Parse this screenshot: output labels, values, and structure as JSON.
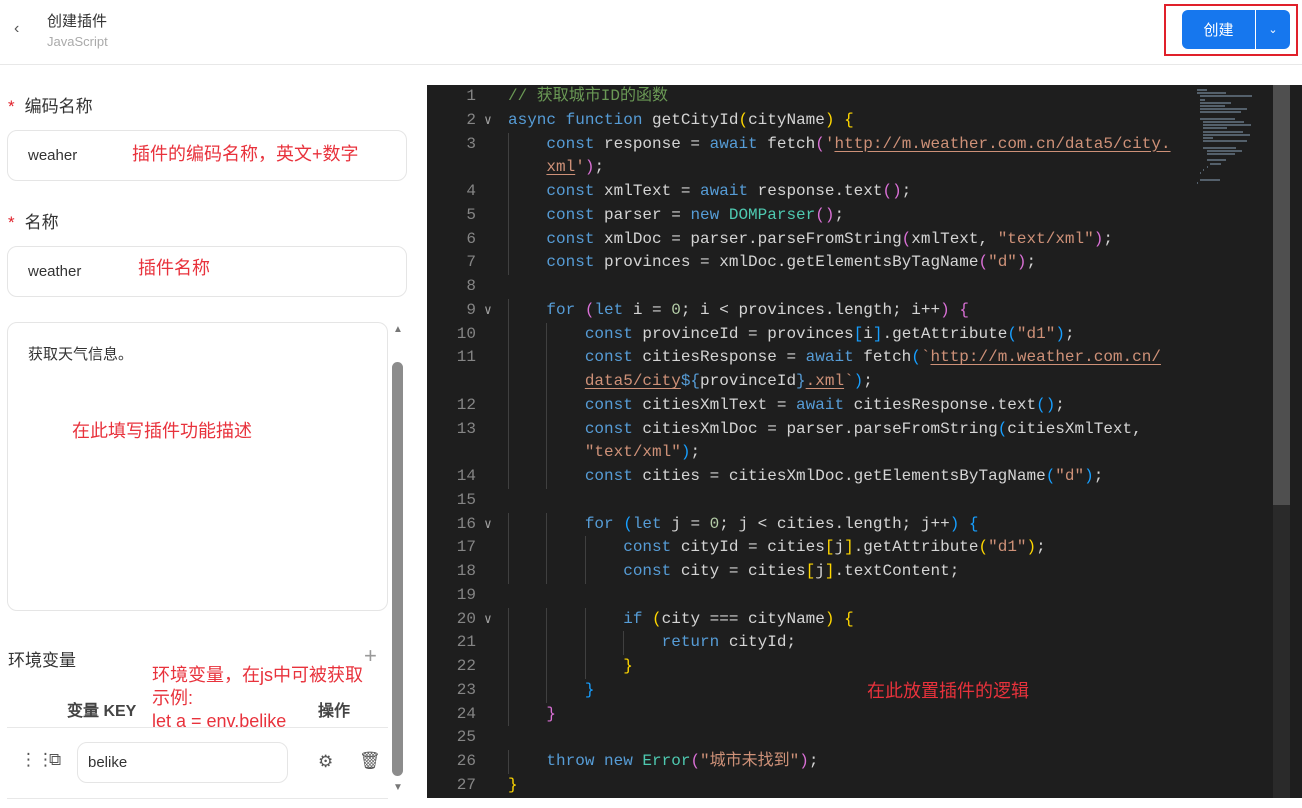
{
  "header": {
    "back_icon": "chevron-left-icon",
    "title": "创建插件",
    "subtitle": "JavaScript",
    "create_label": "创建",
    "dropdown_icon": "chevron-down-icon"
  },
  "form": {
    "code_name": {
      "label": "编码名称",
      "required": "*",
      "value": "weaher",
      "annotation": "插件的编码名称，英文+数字"
    },
    "name": {
      "label": "名称",
      "required": "*",
      "value": "weather",
      "annotation": "插件名称"
    },
    "description": {
      "value": "获取天气信息。",
      "annotation": "在此填写插件功能描述"
    },
    "env": {
      "title": "环境变量",
      "add_icon": "plus-icon",
      "col_key": "变量 KEY",
      "col_action": "操作",
      "annotation": [
        "环境变量，在js中可被获取",
        "示例:",
        "let a = env.belike"
      ],
      "rows": [
        {
          "key": "belike"
        }
      ]
    }
  },
  "editor": {
    "annotation": "在此放置插件的逻辑",
    "colors": {
      "keyword": "#569cd6",
      "string": "#ce9178",
      "comment": "#6a9955",
      "class": "#4ec9b0",
      "background": "#1e1e1e"
    },
    "rows": [
      {
        "n": "1",
        "t": [
          [
            "c",
            "// 获取城市ID的函数"
          ]
        ]
      },
      {
        "n": "2",
        "f": 1,
        "t": [
          [
            "k",
            "async "
          ],
          [
            "k",
            "function "
          ],
          [
            "v",
            "getCityId"
          ],
          [
            "b1",
            "("
          ],
          [
            "v",
            "cityName"
          ],
          [
            "b1",
            ")"
          ],
          [
            "v",
            " "
          ],
          [
            "b1",
            "{"
          ]
        ]
      },
      {
        "n": "3",
        "t": [
          [
            "v",
            "    "
          ],
          [
            "k",
            "const "
          ],
          [
            "v",
            "response = "
          ],
          [
            "k",
            "await "
          ],
          [
            "v",
            "fetch"
          ],
          [
            "b2",
            "("
          ],
          [
            "s",
            "'"
          ],
          [
            "su",
            "http://m.weather.com.cn/data5/city."
          ]
        ]
      },
      {
        "n": "",
        "t": [
          [
            "v",
            "    "
          ],
          [
            "su",
            "xml"
          ],
          [
            "s",
            "'"
          ],
          [
            "b2",
            ")"
          ],
          [
            "v",
            ";"
          ]
        ]
      },
      {
        "n": "4",
        "t": [
          [
            "v",
            "    "
          ],
          [
            "k",
            "const "
          ],
          [
            "v",
            "xmlText = "
          ],
          [
            "k",
            "await "
          ],
          [
            "v",
            "response.text"
          ],
          [
            "b2",
            "()"
          ],
          [
            "v",
            ";"
          ]
        ]
      },
      {
        "n": "5",
        "t": [
          [
            "v",
            "    "
          ],
          [
            "k",
            "const "
          ],
          [
            "v",
            "parser = "
          ],
          [
            "k",
            "new "
          ],
          [
            "cl",
            "DOMParser"
          ],
          [
            "b2",
            "()"
          ],
          [
            "v",
            ";"
          ]
        ]
      },
      {
        "n": "6",
        "t": [
          [
            "v",
            "    "
          ],
          [
            "k",
            "const "
          ],
          [
            "v",
            "xmlDoc = parser.parseFromString"
          ],
          [
            "b2",
            "("
          ],
          [
            "v",
            "xmlText, "
          ],
          [
            "s",
            "\"text/xml\""
          ],
          [
            "b2",
            ")"
          ],
          [
            "v",
            ";"
          ]
        ]
      },
      {
        "n": "7",
        "t": [
          [
            "v",
            "    "
          ],
          [
            "k",
            "const "
          ],
          [
            "v",
            "provinces = xmlDoc.getElementsByTagName"
          ],
          [
            "b2",
            "("
          ],
          [
            "s",
            "\"d\""
          ],
          [
            "b2",
            ")"
          ],
          [
            "v",
            ";"
          ]
        ]
      },
      {
        "n": "8",
        "t": []
      },
      {
        "n": "9",
        "f": 1,
        "t": [
          [
            "v",
            "    "
          ],
          [
            "k",
            "for "
          ],
          [
            "b2",
            "("
          ],
          [
            "k",
            "let "
          ],
          [
            "v",
            "i = "
          ],
          [
            "n",
            "0"
          ],
          [
            "v",
            "; i < provinces.length; i++"
          ],
          [
            "b2",
            ")"
          ],
          [
            "v",
            " "
          ],
          [
            "b2",
            "{"
          ]
        ]
      },
      {
        "n": "10",
        "t": [
          [
            "v",
            "        "
          ],
          [
            "k",
            "const "
          ],
          [
            "v",
            "provinceId = provinces"
          ],
          [
            "b3",
            "["
          ],
          [
            "v",
            "i"
          ],
          [
            "b3",
            "]"
          ],
          [
            "v",
            ".getAttribute"
          ],
          [
            "b3",
            "("
          ],
          [
            "s",
            "\"d1\""
          ],
          [
            "b3",
            ")"
          ],
          [
            "v",
            ";"
          ]
        ]
      },
      {
        "n": "11",
        "t": [
          [
            "v",
            "        "
          ],
          [
            "k",
            "const "
          ],
          [
            "v",
            "citiesResponse = "
          ],
          [
            "k",
            "await "
          ],
          [
            "v",
            "fetch"
          ],
          [
            "b3",
            "("
          ],
          [
            "s",
            "`"
          ],
          [
            "su",
            "http://m.weather.com.cn/"
          ]
        ]
      },
      {
        "n": "",
        "t": [
          [
            "v",
            "        "
          ],
          [
            "su",
            "data5/city"
          ],
          [
            "k",
            "${"
          ],
          [
            "v",
            "provinceId"
          ],
          [
            "k",
            "}"
          ],
          [
            "su",
            ".xml"
          ],
          [
            "s",
            "`"
          ],
          [
            "b3",
            ")"
          ],
          [
            "v",
            ";"
          ]
        ]
      },
      {
        "n": "12",
        "t": [
          [
            "v",
            "        "
          ],
          [
            "k",
            "const "
          ],
          [
            "v",
            "citiesXmlText = "
          ],
          [
            "k",
            "await "
          ],
          [
            "v",
            "citiesResponse.text"
          ],
          [
            "b3",
            "()"
          ],
          [
            "v",
            ";"
          ]
        ]
      },
      {
        "n": "13",
        "t": [
          [
            "v",
            "        "
          ],
          [
            "k",
            "const "
          ],
          [
            "v",
            "citiesXmlDoc = parser.parseFromString"
          ],
          [
            "b3",
            "("
          ],
          [
            "v",
            "citiesXmlText,"
          ]
        ]
      },
      {
        "n": "",
        "t": [
          [
            "v",
            "        "
          ],
          [
            "s",
            "\"text/xml\""
          ],
          [
            "b3",
            ")"
          ],
          [
            "v",
            ";"
          ]
        ]
      },
      {
        "n": "14",
        "t": [
          [
            "v",
            "        "
          ],
          [
            "k",
            "const "
          ],
          [
            "v",
            "cities = citiesXmlDoc.getElementsByTagName"
          ],
          [
            "b3",
            "("
          ],
          [
            "s",
            "\"d\""
          ],
          [
            "b3",
            ")"
          ],
          [
            "v",
            ";"
          ]
        ]
      },
      {
        "n": "15",
        "t": []
      },
      {
        "n": "16",
        "f": 1,
        "t": [
          [
            "v",
            "        "
          ],
          [
            "k",
            "for "
          ],
          [
            "b3",
            "("
          ],
          [
            "k",
            "let "
          ],
          [
            "v",
            "j = "
          ],
          [
            "n",
            "0"
          ],
          [
            "v",
            "; j < cities.length; j++"
          ],
          [
            "b3",
            ")"
          ],
          [
            "v",
            " "
          ],
          [
            "b3",
            "{"
          ]
        ]
      },
      {
        "n": "17",
        "t": [
          [
            "v",
            "            "
          ],
          [
            "k",
            "const "
          ],
          [
            "v",
            "cityId = cities"
          ],
          [
            "b1",
            "["
          ],
          [
            "v",
            "j"
          ],
          [
            "b1",
            "]"
          ],
          [
            "v",
            ".getAttribute"
          ],
          [
            "b1",
            "("
          ],
          [
            "s",
            "\"d1\""
          ],
          [
            "b1",
            ")"
          ],
          [
            "v",
            ";"
          ]
        ]
      },
      {
        "n": "18",
        "t": [
          [
            "v",
            "            "
          ],
          [
            "k",
            "const "
          ],
          [
            "v",
            "city = cities"
          ],
          [
            "b1",
            "["
          ],
          [
            "v",
            "j"
          ],
          [
            "b1",
            "]"
          ],
          [
            "v",
            ".textContent;"
          ]
        ]
      },
      {
        "n": "19",
        "t": []
      },
      {
        "n": "20",
        "f": 1,
        "t": [
          [
            "v",
            "            "
          ],
          [
            "k",
            "if "
          ],
          [
            "b1",
            "("
          ],
          [
            "v",
            "city === cityName"
          ],
          [
            "b1",
            ")"
          ],
          [
            "v",
            " "
          ],
          [
            "b1",
            "{"
          ]
        ]
      },
      {
        "n": "21",
        "t": [
          [
            "v",
            "                "
          ],
          [
            "k",
            "return "
          ],
          [
            "v",
            "cityId;"
          ]
        ]
      },
      {
        "n": "22",
        "t": [
          [
            "v",
            "            "
          ],
          [
            "b1",
            "}"
          ]
        ]
      },
      {
        "n": "23",
        "t": [
          [
            "v",
            "        "
          ],
          [
            "b3",
            "}"
          ]
        ]
      },
      {
        "n": "24",
        "t": [
          [
            "v",
            "    "
          ],
          [
            "b2",
            "}"
          ]
        ]
      },
      {
        "n": "25",
        "t": []
      },
      {
        "n": "26",
        "t": [
          [
            "v",
            "    "
          ],
          [
            "k",
            "throw "
          ],
          [
            "k",
            "new "
          ],
          [
            "cl",
            "Error"
          ],
          [
            "b2",
            "("
          ],
          [
            "s",
            "\"城市未找到\""
          ],
          [
            "b2",
            ")"
          ],
          [
            "v",
            ";"
          ]
        ]
      },
      {
        "n": "27",
        "t": [
          [
            "b1",
            "}"
          ]
        ]
      }
    ]
  }
}
